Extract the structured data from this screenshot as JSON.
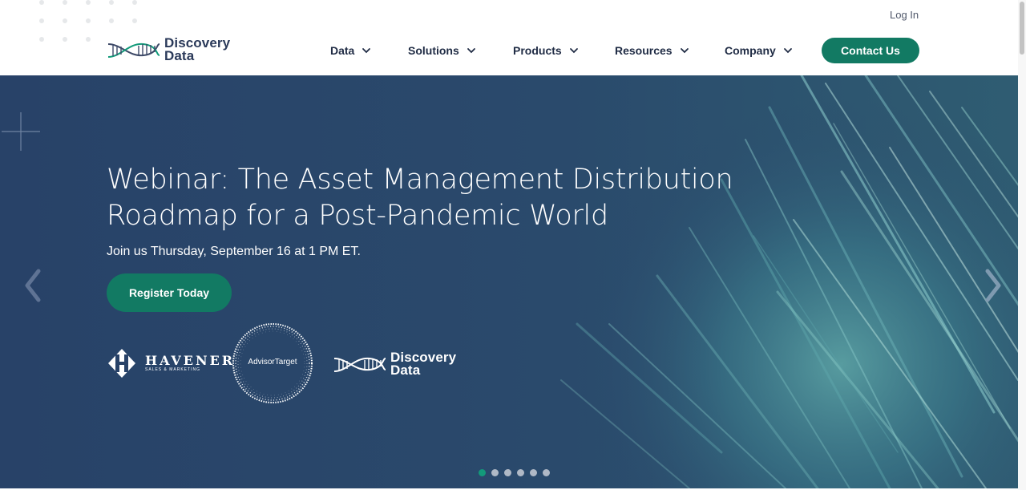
{
  "brand": {
    "line1": "Discovery",
    "line2": "Data"
  },
  "header": {
    "login_label": "Log In",
    "contact_label": "Contact Us"
  },
  "nav": {
    "items": [
      {
        "label": "Data",
        "icon": "chevron-down-icon"
      },
      {
        "label": "Solutions",
        "icon": "chevron-down-icon"
      },
      {
        "label": "Products",
        "icon": "chevron-down-icon"
      },
      {
        "label": "Resources",
        "icon": "chevron-down-icon"
      },
      {
        "label": "Company",
        "icon": "chevron-down-icon"
      }
    ]
  },
  "hero": {
    "headline_line1": "Webinar: The Asset Management Distribution",
    "headline_line2": "Roadmap for a Post-Pandemic World",
    "subline": "Join us Thursday, September 16 at 1 PM ET.",
    "cta_label": "Register Today",
    "partners": {
      "havener_name": "HAVENER",
      "havener_tag": "SALES & MARKETING",
      "advisor_label": "AdvisorTarget",
      "discovery_line1": "Discovery",
      "discovery_line2": "Data"
    },
    "prev_icon": "chevron-left-icon",
    "next_icon": "chevron-right-icon",
    "slide_count": 6,
    "active_slide": 1
  },
  "colors": {
    "primary_green": "#127a63",
    "hero_navy": "#284268",
    "dot_active": "#139a7a",
    "text_dark": "#1f2b44"
  }
}
